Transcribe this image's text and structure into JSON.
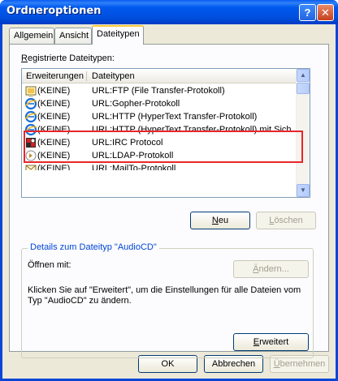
{
  "window": {
    "title": "Ordneroptionen",
    "help_glyph": "?",
    "close_glyph": "✕"
  },
  "tabs": [
    {
      "label": "Allgemein",
      "active": false
    },
    {
      "label": "Ansicht",
      "active": false
    },
    {
      "label": "Dateitypen",
      "active": true
    }
  ],
  "registered": {
    "label_first": "R",
    "label_rest": "egistrierte Dateitypen:",
    "columns": [
      "Erweiterungen",
      "Dateitypen"
    ],
    "rows": [
      {
        "ext": "(KEINE)",
        "type": "URL:FTP (File Transfer-Protokoll)",
        "icon": "ftp-icon"
      },
      {
        "ext": "(KEINE)",
        "type": "URL:Gopher-Protokoll",
        "icon": "ie-icon"
      },
      {
        "ext": "(KEINE)",
        "type": "URL:HTTP (HyperText Transfer-Protokoll)",
        "icon": "ie-icon"
      },
      {
        "ext": "(KEINE)",
        "type": "URL:HTTP (HyperText Transfer-Protokoll) mit Sich...",
        "icon": "ie-icon"
      },
      {
        "ext": "(KEINE)",
        "type": "URL:IRC Protocol",
        "icon": "irc-icon"
      },
      {
        "ext": "(KEINE)",
        "type": "URL:LDAP-Protokoll",
        "icon": "ldap-icon"
      },
      {
        "ext": "(KEINE)",
        "type": "URL:MailTo-Protokoll",
        "icon": "mail-icon"
      }
    ]
  },
  "buttons": {
    "new_first": "N",
    "new_rest": "eu",
    "delete_first": "L",
    "delete_rest": "öschen",
    "change_first": "Ä",
    "change_rest": "ndern...",
    "advanced_first": "E",
    "advanced_rest": "rweitert",
    "ok": "OK",
    "cancel": "Abbrechen",
    "apply_first": "Ü",
    "apply_rest": "bernehmen"
  },
  "details": {
    "group_title": "Details zum Dateityp \"AudioCD\"",
    "opens_with": "Öffnen mit:",
    "description_line1": "Klicken Sie auf \"Erweitert\", um die Einstellungen für alle Dateien vom",
    "description_line2": "Typ \"AudioCD\" zu ändern."
  }
}
